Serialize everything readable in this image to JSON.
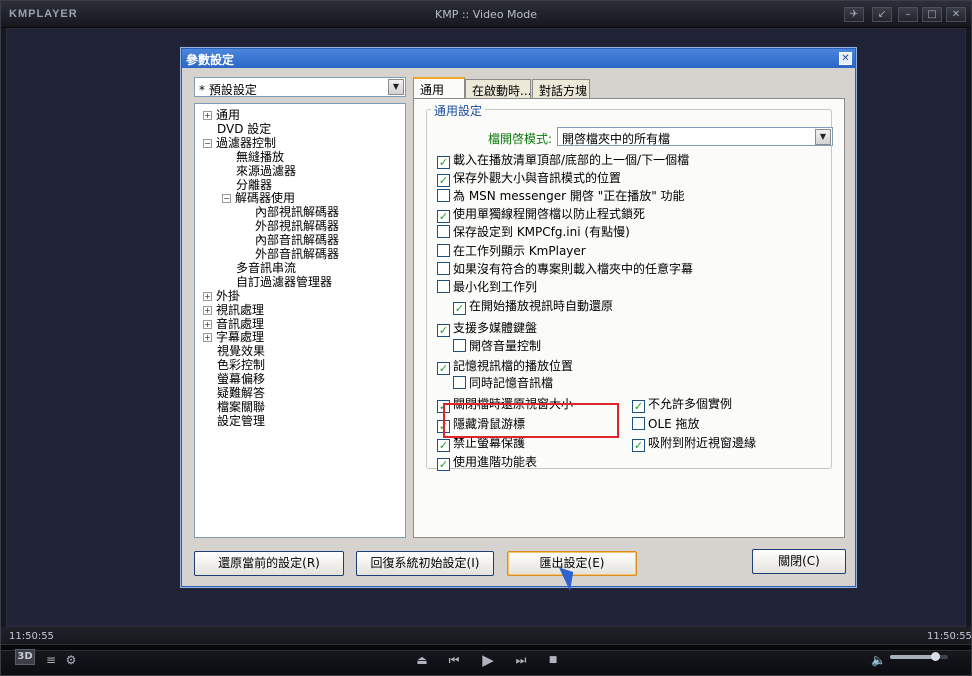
{
  "player": {
    "logo": "KMPLAYER",
    "title": "KMP :: Video Mode",
    "time_left": "11:50:55",
    "time_right": "11:50:55",
    "badge_3d": "3D",
    "volume_fraction": 0.79
  },
  "dialog": {
    "title": "參數設定",
    "preset": "* 預設設定",
    "tree": [
      {
        "label": "通用",
        "level": 0,
        "expander": "+"
      },
      {
        "label": "DVD 設定",
        "level": 0
      },
      {
        "label": "過濾器控制",
        "level": 0,
        "expander": "-"
      },
      {
        "label": "無縫播放",
        "level": 1
      },
      {
        "label": "來源過濾器",
        "level": 1
      },
      {
        "label": "分離器",
        "level": 1
      },
      {
        "label": "解碼器使用",
        "level": 1,
        "expander": "-"
      },
      {
        "label": "內部視訊解碼器",
        "level": 2
      },
      {
        "label": "外部視訊解碼器",
        "level": 2
      },
      {
        "label": "內部音訊解碼器",
        "level": 2
      },
      {
        "label": "外部音訊解碼器",
        "level": 2
      },
      {
        "label": "多音訊串流",
        "level": 1
      },
      {
        "label": "自訂過濾器管理器",
        "level": 1
      },
      {
        "label": "外掛",
        "level": 0,
        "expander": "+"
      },
      {
        "label": "視訊處理",
        "level": 0,
        "expander": "+"
      },
      {
        "label": "音訊處理",
        "level": 0,
        "expander": "+"
      },
      {
        "label": "字幕處理",
        "level": 0,
        "expander": "+"
      },
      {
        "label": "視覺效果",
        "level": 0
      },
      {
        "label": "色彩控制",
        "level": 0
      },
      {
        "label": "螢幕偏移",
        "level": 0
      },
      {
        "label": "疑難解答",
        "level": 0
      },
      {
        "label": "檔案關聯",
        "level": 0
      },
      {
        "label": "設定管理",
        "level": 0
      }
    ],
    "tabs": [
      "通用",
      "在啟動時...",
      "對話方塊"
    ],
    "group_label": "通用設定",
    "open_mode_label": "檔開啓模式:",
    "open_mode_value": "開啓檔夾中的所有檔",
    "options": [
      {
        "label": "載入在播放清單頂部/底部的上一個/下一個檔",
        "checked": true
      },
      {
        "label": "保存外觀大小與音訊模式的位置",
        "checked": true
      },
      {
        "label": "為 MSN messenger 開啓 \"正在播放\" 功能",
        "checked": false
      },
      {
        "label": "使用單獨線程開啓檔以防止程式鎖死",
        "checked": true
      },
      {
        "label": "保存設定到 KMPCfg.ini (有點慢)",
        "checked": false
      },
      {
        "label": "在工作列顯示 KmPlayer",
        "checked": false
      },
      {
        "label": "如果沒有符合的專案則載入檔夾中的任意字幕",
        "checked": false
      },
      {
        "label": "最小化到工作列",
        "checked": false
      },
      {
        "label": "在開始播放視訊時自動還原",
        "checked": true
      },
      {
        "label": "支援多媒體鍵盤",
        "checked": true
      },
      {
        "label": "開啓音量控制",
        "checked": false
      },
      {
        "label": "記憶視訊檔的播放位置",
        "checked": true
      },
      {
        "label": "同時記憶音訊檔",
        "checked": false
      }
    ],
    "options_left": [
      {
        "label": "關閉檔時還原視窗大小",
        "checked": true
      },
      {
        "label": "隱藏滑鼠游標",
        "checked": true
      },
      {
        "label": "禁止螢幕保護",
        "checked": true
      },
      {
        "label": "使用進階功能表",
        "checked": true
      }
    ],
    "options_right": [
      {
        "label": "不允許多個實例",
        "checked": true
      },
      {
        "label": "OLE 拖放",
        "checked": false
      },
      {
        "label": "吸附到附近視窗邊緣",
        "checked": true
      }
    ],
    "buttons": {
      "restore": "還原當前的設定(R)",
      "reset": "回復系統初始設定(I)",
      "export": "匯出設定(E)",
      "close": "關閉(C)"
    }
  }
}
